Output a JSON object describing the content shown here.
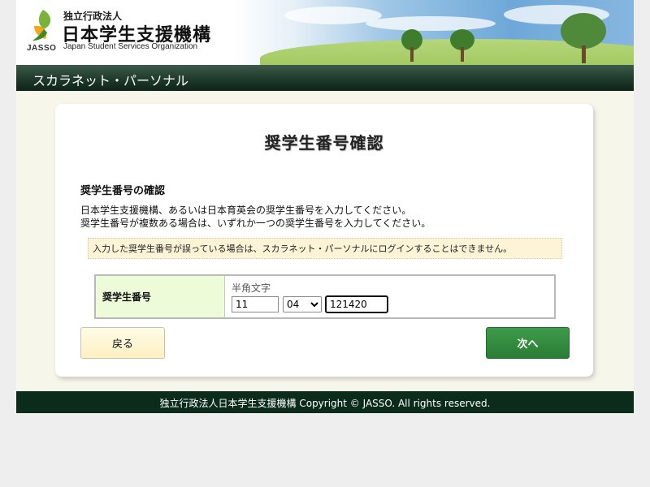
{
  "header": {
    "org_small": "独立行政法人",
    "org_name": "日本学生支援機構",
    "org_english": "Japan Student Services Organization",
    "logo_text": "JASSO"
  },
  "nav": {
    "title": "スカラネット・パーソナル"
  },
  "page": {
    "title": "奨学生番号確認",
    "section_heading": "奨学生番号の確認",
    "description_line1": "日本学生支援機構、あるいは日本育英会の奨学生番号を入力してください。",
    "description_line2": "奨学生番号が複数ある場合は、いずれか一つの奨学生番号を入力してください。",
    "notice": "入力した奨学生番号が誤っている場合は、スカラネット・パーソナルにログインすることはできません。"
  },
  "form": {
    "label": "奨学生番号",
    "hint": "半角文字",
    "part1_value": "11",
    "part2_selected": "04",
    "part3_value": "121420"
  },
  "buttons": {
    "back": "戻る",
    "next": "次へ"
  },
  "footer": {
    "text": "独立行政法人日本学生支援機構 Copyright © JASSO. All rights reserved."
  },
  "colors": {
    "nav_bar": "#1f3a2b",
    "footer_bg": "#0c2c1b",
    "next_button": "#2a7d35",
    "back_button": "#fdf0c2",
    "notice_bg": "#fdf3d6",
    "label_cell_bg": "#edfbd8"
  },
  "icons": {
    "logo": "jasso-leaf-logo-icon",
    "select_arrow": "chevron-down-icon"
  }
}
